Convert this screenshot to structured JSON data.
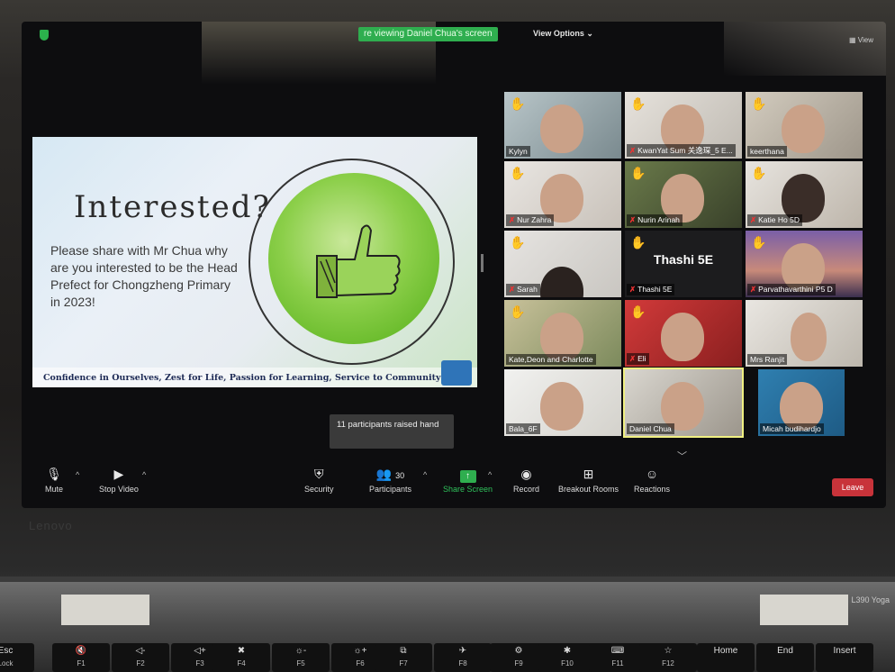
{
  "top_bar": {
    "viewing_banner": "re viewing Daniel Chua's screen",
    "view_options": "View Options ⌄",
    "view": "View"
  },
  "slide": {
    "title": "Interested?",
    "body": "Please share with Mr Chua why are you interested to be the Head Prefect for Chongzheng Primary in 2023!",
    "motto": "Confidence in Ourselves, Zest for Life, Passion for Learning, Service to Community"
  },
  "participants": [
    {
      "name": "Kylyn",
      "hand": true,
      "muted": false
    },
    {
      "name": "KwanYat Sum 关逸琛_5 E...",
      "hand": true,
      "muted": true
    },
    {
      "name": "keerthana",
      "hand": true,
      "muted": false
    },
    {
      "name": "Nur Zahra",
      "hand": true,
      "muted": true
    },
    {
      "name": "Nurin Arinah",
      "hand": true,
      "muted": true
    },
    {
      "name": "Katie Ho 5D",
      "hand": true,
      "muted": true
    },
    {
      "name": "Sarah",
      "hand": true,
      "muted": true
    },
    {
      "name": "Thashi 5E",
      "hand": true,
      "muted": true,
      "big_label": "Thashi 5E"
    },
    {
      "name": "Parvathavarthini P5 D",
      "hand": true,
      "muted": true
    },
    {
      "name": "Kate,Deon and Charlotte",
      "hand": true,
      "muted": false
    },
    {
      "name": "Eli",
      "hand": true,
      "muted": true
    },
    {
      "name": "Mrs Ranjit",
      "hand": false,
      "muted": false
    },
    {
      "name": "Bala_6F",
      "hand": false,
      "muted": false
    },
    {
      "name": "Daniel Chua",
      "hand": false,
      "muted": false
    },
    {
      "name": "Micah budihardjo",
      "hand": false,
      "muted": false
    }
  ],
  "tooltip": "11 participants raised hand",
  "toolbar": {
    "mute": "Mute",
    "stop_video": "Stop Video",
    "security": "Security",
    "participants": "Participants",
    "participant_count": "30",
    "share_screen": "Share Screen",
    "record": "Record",
    "breakout_rooms": "Breakout Rooms",
    "reactions": "Reactions",
    "leave": "Leave"
  },
  "laptop": {
    "brand": "Lenovo",
    "model": "L390 Yoga"
  },
  "keyboard": [
    {
      "top": "Esc",
      "bottom": "Lock"
    },
    {
      "top": "🔇",
      "bottom": "F1"
    },
    {
      "top": "◁-",
      "bottom": "F2"
    },
    {
      "top": "◁+",
      "bottom": "F3"
    },
    {
      "top": "✖",
      "bottom": "F4"
    },
    {
      "top": "☼-",
      "bottom": "F5"
    },
    {
      "top": "☼+",
      "bottom": "F6"
    },
    {
      "top": "⧉",
      "bottom": "F7"
    },
    {
      "top": "✈",
      "bottom": "F8"
    },
    {
      "top": "⚙",
      "bottom": "F9"
    },
    {
      "top": "✱",
      "bottom": "F10"
    },
    {
      "top": "⌨",
      "bottom": "F11"
    },
    {
      "top": "☆",
      "bottom": "F12"
    },
    {
      "top": "Home",
      "bottom": ""
    },
    {
      "top": "End",
      "bottom": ""
    },
    {
      "top": "Insert",
      "bottom": ""
    }
  ]
}
